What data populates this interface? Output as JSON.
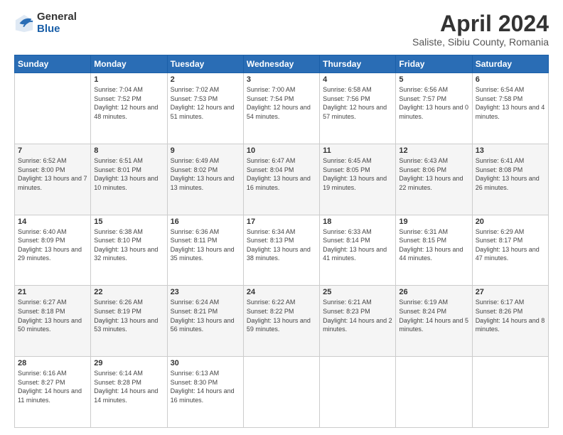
{
  "logo": {
    "general": "General",
    "blue": "Blue"
  },
  "header": {
    "month": "April 2024",
    "location": "Saliste, Sibiu County, Romania"
  },
  "weekdays": [
    "Sunday",
    "Monday",
    "Tuesday",
    "Wednesday",
    "Thursday",
    "Friday",
    "Saturday"
  ],
  "weeks": [
    [
      {
        "day": "",
        "sunrise": "",
        "sunset": "",
        "daylight": ""
      },
      {
        "day": "1",
        "sunrise": "Sunrise: 7:04 AM",
        "sunset": "Sunset: 7:52 PM",
        "daylight": "Daylight: 12 hours and 48 minutes."
      },
      {
        "day": "2",
        "sunrise": "Sunrise: 7:02 AM",
        "sunset": "Sunset: 7:53 PM",
        "daylight": "Daylight: 12 hours and 51 minutes."
      },
      {
        "day": "3",
        "sunrise": "Sunrise: 7:00 AM",
        "sunset": "Sunset: 7:54 PM",
        "daylight": "Daylight: 12 hours and 54 minutes."
      },
      {
        "day": "4",
        "sunrise": "Sunrise: 6:58 AM",
        "sunset": "Sunset: 7:56 PM",
        "daylight": "Daylight: 12 hours and 57 minutes."
      },
      {
        "day": "5",
        "sunrise": "Sunrise: 6:56 AM",
        "sunset": "Sunset: 7:57 PM",
        "daylight": "Daylight: 13 hours and 0 minutes."
      },
      {
        "day": "6",
        "sunrise": "Sunrise: 6:54 AM",
        "sunset": "Sunset: 7:58 PM",
        "daylight": "Daylight: 13 hours and 4 minutes."
      }
    ],
    [
      {
        "day": "7",
        "sunrise": "Sunrise: 6:52 AM",
        "sunset": "Sunset: 8:00 PM",
        "daylight": "Daylight: 13 hours and 7 minutes."
      },
      {
        "day": "8",
        "sunrise": "Sunrise: 6:51 AM",
        "sunset": "Sunset: 8:01 PM",
        "daylight": "Daylight: 13 hours and 10 minutes."
      },
      {
        "day": "9",
        "sunrise": "Sunrise: 6:49 AM",
        "sunset": "Sunset: 8:02 PM",
        "daylight": "Daylight: 13 hours and 13 minutes."
      },
      {
        "day": "10",
        "sunrise": "Sunrise: 6:47 AM",
        "sunset": "Sunset: 8:04 PM",
        "daylight": "Daylight: 13 hours and 16 minutes."
      },
      {
        "day": "11",
        "sunrise": "Sunrise: 6:45 AM",
        "sunset": "Sunset: 8:05 PM",
        "daylight": "Daylight: 13 hours and 19 minutes."
      },
      {
        "day": "12",
        "sunrise": "Sunrise: 6:43 AM",
        "sunset": "Sunset: 8:06 PM",
        "daylight": "Daylight: 13 hours and 22 minutes."
      },
      {
        "day": "13",
        "sunrise": "Sunrise: 6:41 AM",
        "sunset": "Sunset: 8:08 PM",
        "daylight": "Daylight: 13 hours and 26 minutes."
      }
    ],
    [
      {
        "day": "14",
        "sunrise": "Sunrise: 6:40 AM",
        "sunset": "Sunset: 8:09 PM",
        "daylight": "Daylight: 13 hours and 29 minutes."
      },
      {
        "day": "15",
        "sunrise": "Sunrise: 6:38 AM",
        "sunset": "Sunset: 8:10 PM",
        "daylight": "Daylight: 13 hours and 32 minutes."
      },
      {
        "day": "16",
        "sunrise": "Sunrise: 6:36 AM",
        "sunset": "Sunset: 8:11 PM",
        "daylight": "Daylight: 13 hours and 35 minutes."
      },
      {
        "day": "17",
        "sunrise": "Sunrise: 6:34 AM",
        "sunset": "Sunset: 8:13 PM",
        "daylight": "Daylight: 13 hours and 38 minutes."
      },
      {
        "day": "18",
        "sunrise": "Sunrise: 6:33 AM",
        "sunset": "Sunset: 8:14 PM",
        "daylight": "Daylight: 13 hours and 41 minutes."
      },
      {
        "day": "19",
        "sunrise": "Sunrise: 6:31 AM",
        "sunset": "Sunset: 8:15 PM",
        "daylight": "Daylight: 13 hours and 44 minutes."
      },
      {
        "day": "20",
        "sunrise": "Sunrise: 6:29 AM",
        "sunset": "Sunset: 8:17 PM",
        "daylight": "Daylight: 13 hours and 47 minutes."
      }
    ],
    [
      {
        "day": "21",
        "sunrise": "Sunrise: 6:27 AM",
        "sunset": "Sunset: 8:18 PM",
        "daylight": "Daylight: 13 hours and 50 minutes."
      },
      {
        "day": "22",
        "sunrise": "Sunrise: 6:26 AM",
        "sunset": "Sunset: 8:19 PM",
        "daylight": "Daylight: 13 hours and 53 minutes."
      },
      {
        "day": "23",
        "sunrise": "Sunrise: 6:24 AM",
        "sunset": "Sunset: 8:21 PM",
        "daylight": "Daylight: 13 hours and 56 minutes."
      },
      {
        "day": "24",
        "sunrise": "Sunrise: 6:22 AM",
        "sunset": "Sunset: 8:22 PM",
        "daylight": "Daylight: 13 hours and 59 minutes."
      },
      {
        "day": "25",
        "sunrise": "Sunrise: 6:21 AM",
        "sunset": "Sunset: 8:23 PM",
        "daylight": "Daylight: 14 hours and 2 minutes."
      },
      {
        "day": "26",
        "sunrise": "Sunrise: 6:19 AM",
        "sunset": "Sunset: 8:24 PM",
        "daylight": "Daylight: 14 hours and 5 minutes."
      },
      {
        "day": "27",
        "sunrise": "Sunrise: 6:17 AM",
        "sunset": "Sunset: 8:26 PM",
        "daylight": "Daylight: 14 hours and 8 minutes."
      }
    ],
    [
      {
        "day": "28",
        "sunrise": "Sunrise: 6:16 AM",
        "sunset": "Sunset: 8:27 PM",
        "daylight": "Daylight: 14 hours and 11 minutes."
      },
      {
        "day": "29",
        "sunrise": "Sunrise: 6:14 AM",
        "sunset": "Sunset: 8:28 PM",
        "daylight": "Daylight: 14 hours and 14 minutes."
      },
      {
        "day": "30",
        "sunrise": "Sunrise: 6:13 AM",
        "sunset": "Sunset: 8:30 PM",
        "daylight": "Daylight: 14 hours and 16 minutes."
      },
      {
        "day": "",
        "sunrise": "",
        "sunset": "",
        "daylight": ""
      },
      {
        "day": "",
        "sunrise": "",
        "sunset": "",
        "daylight": ""
      },
      {
        "day": "",
        "sunrise": "",
        "sunset": "",
        "daylight": ""
      },
      {
        "day": "",
        "sunrise": "",
        "sunset": "",
        "daylight": ""
      }
    ]
  ]
}
